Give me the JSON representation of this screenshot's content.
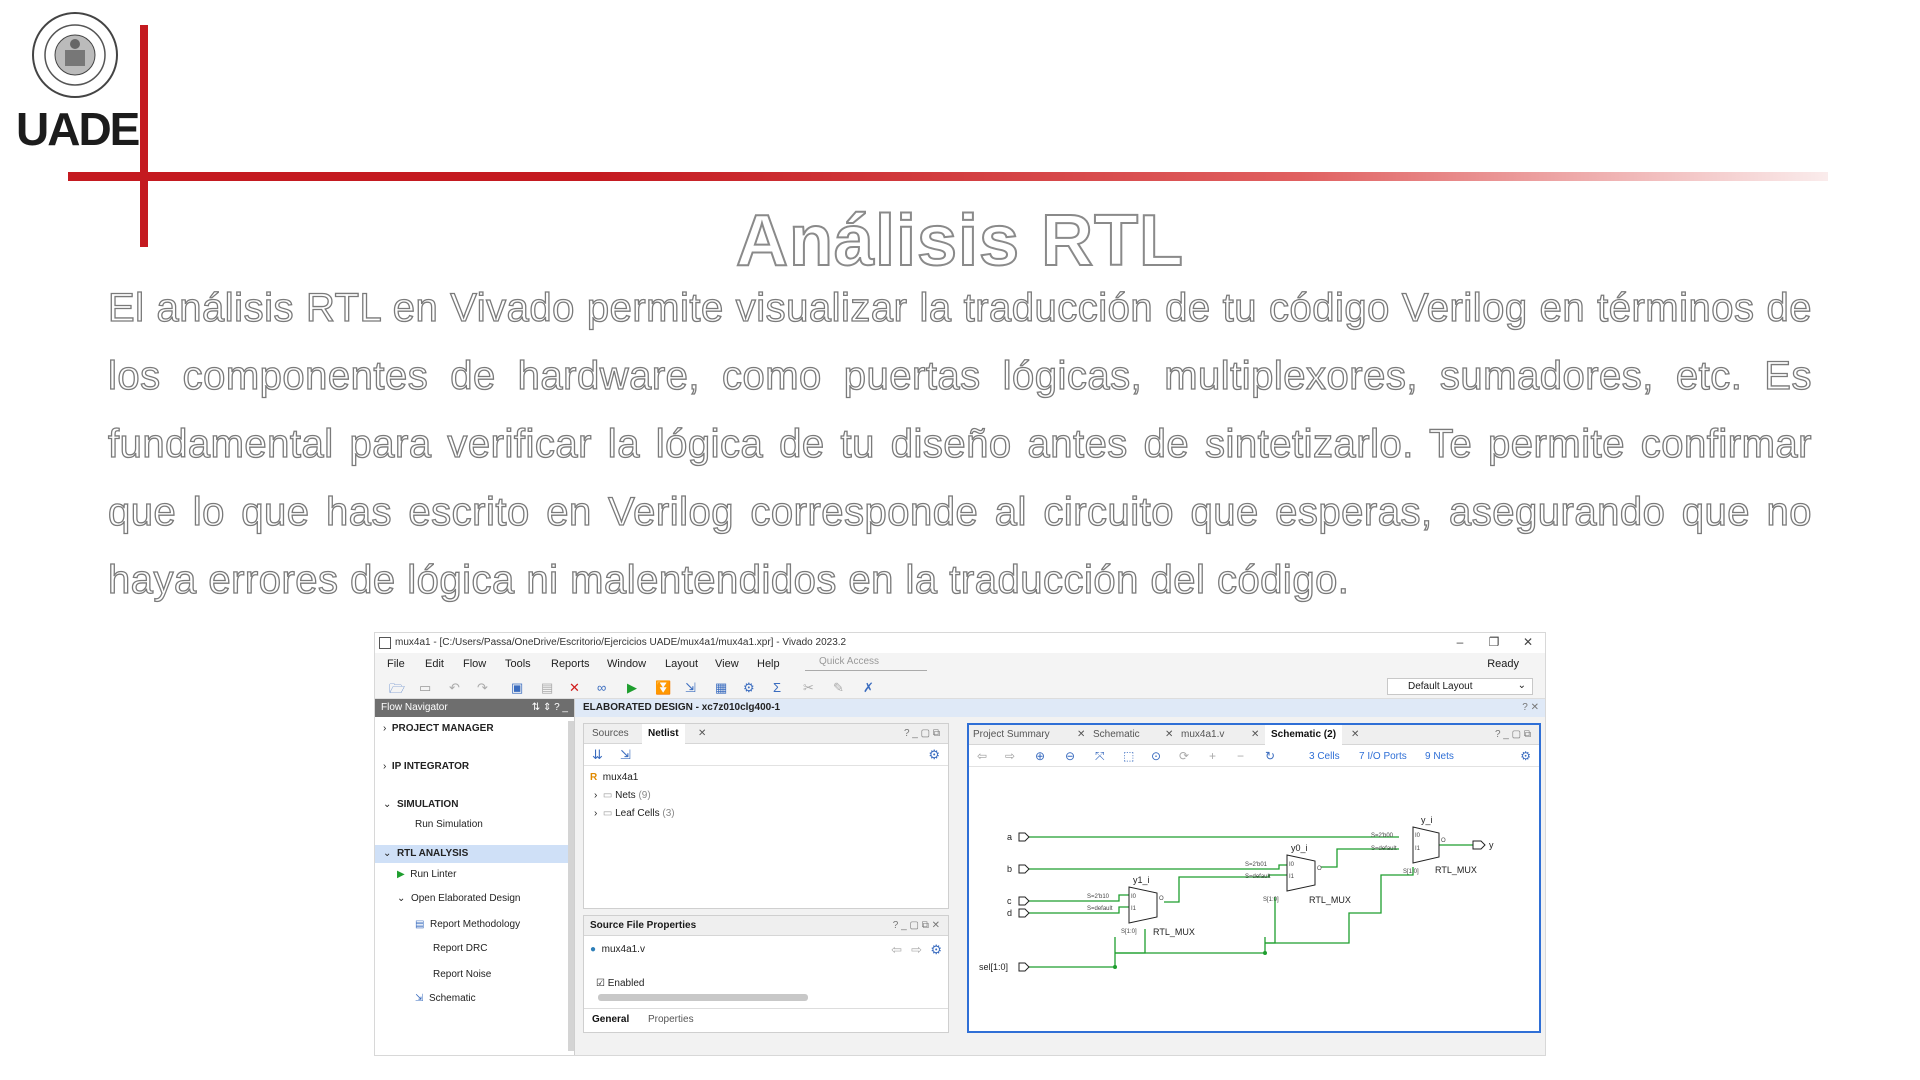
{
  "slide": {
    "logo_text": "UADE",
    "title": "Análisis RTL",
    "body": "El análisis RTL en Vivado permite visualizar la traducción de tu código Verilog en términos de los componentes de hardware, como puertas lógicas, multiplexores, sumadores, etc. Es fundamental para verificar la lógica de tu diseño antes de sintetizarlo. Te permite confirmar que lo que has escrito en Verilog corresponde al circuito que esperas, asegurando que no haya errores de lógica ni malentendidos en la traducción del código."
  },
  "window": {
    "title": "mux4a1 - [C:/Users/Passa/OneDrive/Escritorio/Ejercicios UADE/mux4a1/mux4a1.xpr] - Vivado 2023.2",
    "menu": [
      "File",
      "Edit",
      "Flow",
      "Tools",
      "Reports",
      "Window",
      "Layout",
      "View",
      "Help"
    ],
    "quick_access_placeholder": "Quick Access",
    "status": "Ready",
    "layout_select": "Default Layout"
  },
  "flow_navigator": {
    "header": "Flow Navigator",
    "items": {
      "project_manager": "PROJECT MANAGER",
      "ip_integrator": "IP INTEGRATOR",
      "simulation": "SIMULATION",
      "run_simulation": "Run Simulation",
      "rtl_analysis": "RTL ANALYSIS",
      "run_linter": "Run Linter",
      "open_elaborated": "Open Elaborated Design",
      "report_methodology": "Report Methodology",
      "report_drc": "Report DRC",
      "report_noise": "Report Noise",
      "schematic": "Schematic"
    }
  },
  "elaborated": {
    "header": "ELABORATED DESIGN - xc7z010clg400-1"
  },
  "netlist": {
    "tabs": [
      "Sources",
      "Netlist"
    ],
    "active_tab": "Netlist",
    "top": "mux4a1",
    "nets": "Nets",
    "nets_count": "(9)",
    "leaf_cells": "Leaf Cells",
    "leaf_count": "(3)"
  },
  "source_props": {
    "header": "Source File Properties",
    "file": "mux4a1.v",
    "enabled": "Enabled",
    "tabs": [
      "General",
      "Properties"
    ]
  },
  "schematic": {
    "tabs": [
      "Project Summary",
      "Schematic",
      "mux4a1.v",
      "Schematic (2)"
    ],
    "active_tab": "Schematic (2)",
    "cells": "3 Cells",
    "ports": "7 I/O Ports",
    "nets": "9 Nets",
    "inputs": [
      "a",
      "b",
      "c",
      "d",
      "sel[1:0]"
    ],
    "output": "y",
    "mux1": {
      "inst": "y1_i",
      "type": "RTL_MUX",
      "s": "S[1:0]",
      "i0": "S=2'b10",
      "i1": "S=default"
    },
    "mux2": {
      "inst": "y0_i",
      "type": "RTL_MUX",
      "s": "S[1:0]",
      "i0": "S=2'b01",
      "i1": "S=default"
    },
    "mux3": {
      "inst": "y_i",
      "type": "RTL_MUX",
      "s": "S[1:0]",
      "i0": "S=2'b00",
      "i1": "S=default"
    },
    "pin_i0": "I0",
    "pin_i1": "I1",
    "pin_o": "O"
  },
  "colors": {
    "accent_red": "#c41a20",
    "vivado_blue": "#2f6fd6",
    "wire_green": "#1e9e2e"
  }
}
